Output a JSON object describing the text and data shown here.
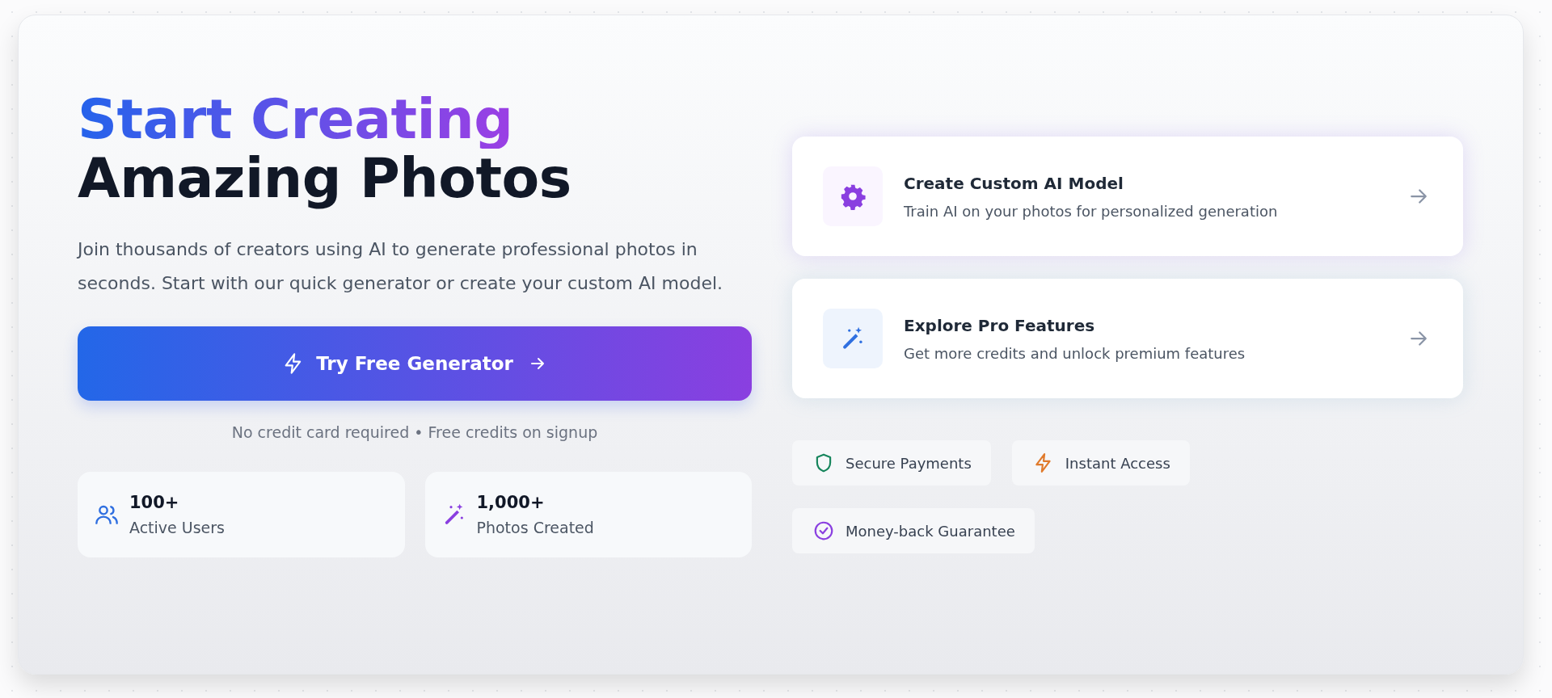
{
  "hero": {
    "title_highlight": "Start Creating",
    "title_rest": "Amazing Photos",
    "description": "Join thousands of creators using AI to generate professional photos in seconds. Start with our quick generator or create your custom AI model.",
    "cta_button": "Try Free Generator",
    "note": "No credit card required • Free credits on signup"
  },
  "stats": [
    {
      "kind": "users",
      "value": "100+",
      "label": "Active Users"
    },
    {
      "kind": "wand",
      "value": "1,000+",
      "label": "Photos Created"
    }
  ],
  "feature_cards": [
    {
      "kind": "gear",
      "title": "Create Custom AI Model",
      "subtitle": "Train AI on your photos for personalized generation"
    },
    {
      "kind": "wand",
      "title": "Explore Pro Features",
      "subtitle": "Get more credits and unlock premium features"
    }
  ],
  "badges": [
    {
      "kind": "shield",
      "label": "Secure Payments",
      "color": "#16855c"
    },
    {
      "kind": "bolt",
      "label": "Instant Access",
      "color": "#e07a2c"
    },
    {
      "kind": "check",
      "label": "Money-back Guarantee",
      "color": "#8a3fe0"
    }
  ]
}
